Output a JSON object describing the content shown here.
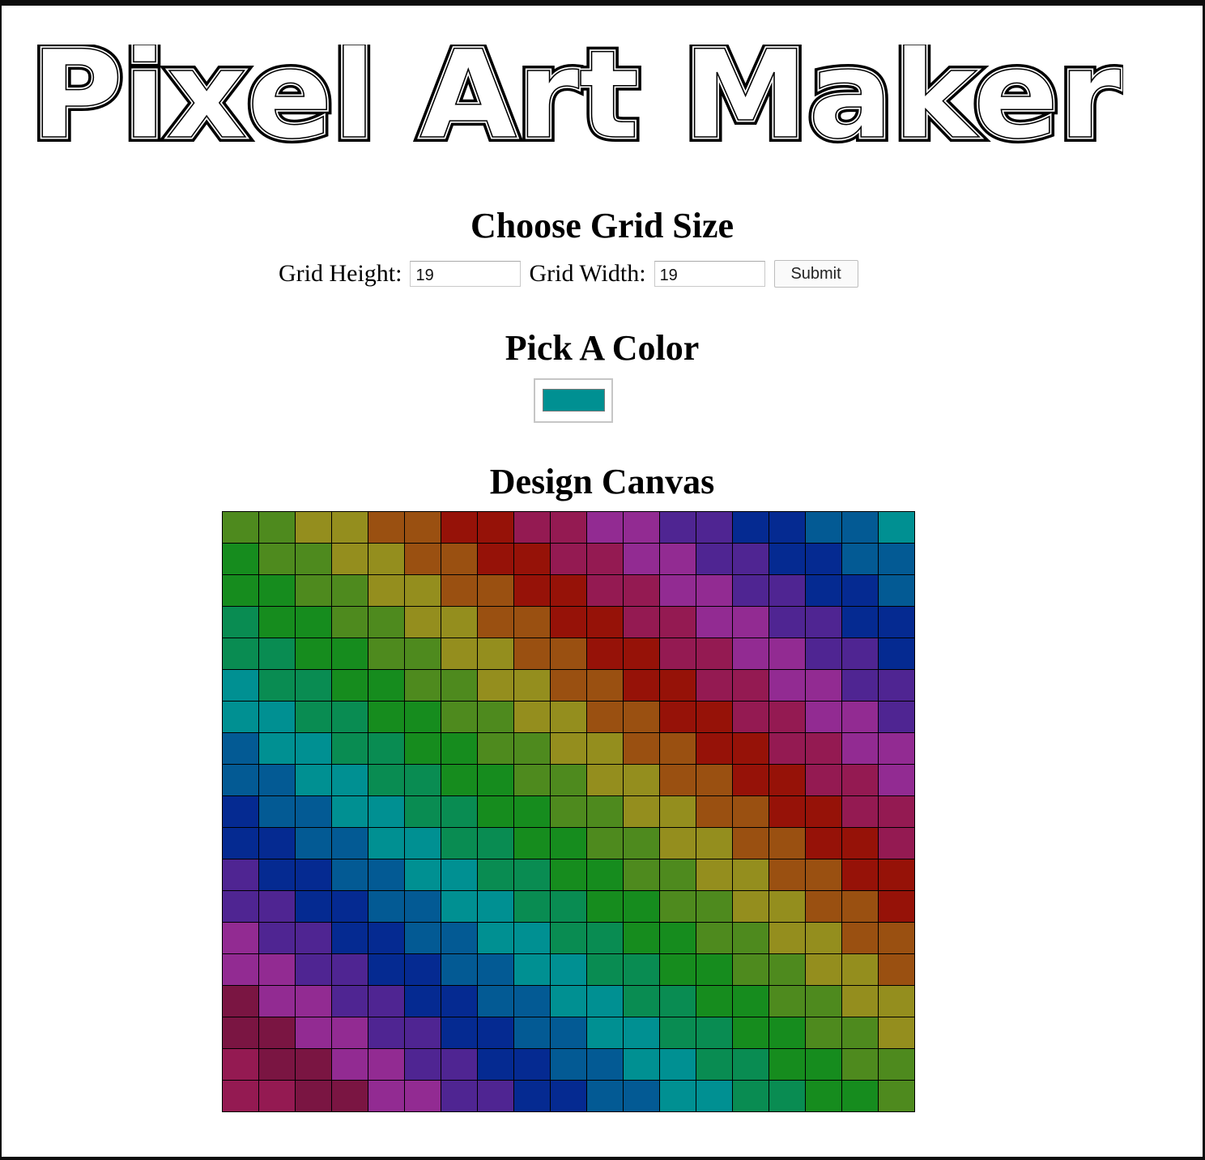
{
  "app": {
    "title": "Pixel Art Maker"
  },
  "grid_size": {
    "heading": "Choose Grid Size",
    "height_label": "Grid Height:",
    "height_value": "19",
    "width_label": "Grid Width:",
    "width_value": "19",
    "submit_label": "Submit"
  },
  "color": {
    "heading": "Pick A Color",
    "value": "#009092"
  },
  "canvas": {
    "heading": "Design Canvas",
    "rows": 19,
    "cols": 19,
    "border_color": "#000000",
    "cells": [
      [
        "#4e8a1e",
        "#4e8a1e",
        "#948e1e",
        "#948e1e",
        "#9a5011",
        "#9a5011",
        "#961208",
        "#961208",
        "#941a52",
        "#941a52",
        "#922b92",
        "#922b92",
        "#4f2592",
        "#4f2592",
        "#052a91",
        "#052a91",
        "#035a94",
        "#035a94",
        "#009092"
      ],
      [
        "#168c1e",
        "#4e8a1e",
        "#4e8a1e",
        "#948e1e",
        "#948e1e",
        "#9a5011",
        "#9a5011",
        "#961208",
        "#961208",
        "#941a52",
        "#941a52",
        "#922b92",
        "#922b92",
        "#4f2592",
        "#4f2592",
        "#052a91",
        "#052a91",
        "#035a94",
        "#035a94"
      ],
      [
        "#168c1e",
        "#168c1e",
        "#4e8a1e",
        "#4e8a1e",
        "#948e1e",
        "#948e1e",
        "#9a5011",
        "#9a5011",
        "#961208",
        "#961208",
        "#941a52",
        "#941a52",
        "#922b92",
        "#922b92",
        "#4f2592",
        "#4f2592",
        "#052a91",
        "#052a91",
        "#035a94"
      ],
      [
        "#098c52",
        "#168c1e",
        "#168c1e",
        "#4e8a1e",
        "#4e8a1e",
        "#948e1e",
        "#948e1e",
        "#9a5011",
        "#9a5011",
        "#961208",
        "#961208",
        "#941a52",
        "#941a52",
        "#922b92",
        "#922b92",
        "#4f2592",
        "#4f2592",
        "#052a91",
        "#052a91"
      ],
      [
        "#098c52",
        "#098c52",
        "#168c1e",
        "#168c1e",
        "#4e8a1e",
        "#4e8a1e",
        "#948e1e",
        "#948e1e",
        "#9a5011",
        "#9a5011",
        "#961208",
        "#961208",
        "#941a52",
        "#941a52",
        "#922b92",
        "#922b92",
        "#4f2592",
        "#4f2592",
        "#052a91"
      ],
      [
        "#009092",
        "#098c52",
        "#098c52",
        "#168c1e",
        "#168c1e",
        "#4e8a1e",
        "#4e8a1e",
        "#948e1e",
        "#948e1e",
        "#9a5011",
        "#9a5011",
        "#961208",
        "#961208",
        "#941a52",
        "#941a52",
        "#922b92",
        "#922b92",
        "#4f2592",
        "#4f2592"
      ],
      [
        "#009092",
        "#009092",
        "#098c52",
        "#098c52",
        "#168c1e",
        "#168c1e",
        "#4e8a1e",
        "#4e8a1e",
        "#948e1e",
        "#948e1e",
        "#9a5011",
        "#9a5011",
        "#961208",
        "#961208",
        "#941a52",
        "#941a52",
        "#922b92",
        "#922b92",
        "#4f2592"
      ],
      [
        "#035a94",
        "#009092",
        "#009092",
        "#098c52",
        "#098c52",
        "#168c1e",
        "#168c1e",
        "#4e8a1e",
        "#4e8a1e",
        "#948e1e",
        "#948e1e",
        "#9a5011",
        "#9a5011",
        "#961208",
        "#961208",
        "#941a52",
        "#941a52",
        "#922b92",
        "#922b92"
      ],
      [
        "#035a94",
        "#035a94",
        "#009092",
        "#009092",
        "#098c52",
        "#098c52",
        "#168c1e",
        "#168c1e",
        "#4e8a1e",
        "#4e8a1e",
        "#948e1e",
        "#948e1e",
        "#9a5011",
        "#9a5011",
        "#961208",
        "#961208",
        "#941a52",
        "#941a52",
        "#922b92"
      ],
      [
        "#052a91",
        "#035a94",
        "#035a94",
        "#009092",
        "#009092",
        "#098c52",
        "#098c52",
        "#168c1e",
        "#168c1e",
        "#4e8a1e",
        "#4e8a1e",
        "#948e1e",
        "#948e1e",
        "#9a5011",
        "#9a5011",
        "#961208",
        "#961208",
        "#941a52",
        "#941a52"
      ],
      [
        "#052a91",
        "#052a91",
        "#035a94",
        "#035a94",
        "#009092",
        "#009092",
        "#098c52",
        "#098c52",
        "#168c1e",
        "#168c1e",
        "#4e8a1e",
        "#4e8a1e",
        "#948e1e",
        "#948e1e",
        "#9a5011",
        "#9a5011",
        "#961208",
        "#961208",
        "#941a52"
      ],
      [
        "#4f2592",
        "#052a91",
        "#052a91",
        "#035a94",
        "#035a94",
        "#009092",
        "#009092",
        "#098c52",
        "#098c52",
        "#168c1e",
        "#168c1e",
        "#4e8a1e",
        "#4e8a1e",
        "#948e1e",
        "#948e1e",
        "#9a5011",
        "#9a5011",
        "#961208",
        "#961208"
      ],
      [
        "#4f2592",
        "#4f2592",
        "#052a91",
        "#052a91",
        "#035a94",
        "#035a94",
        "#009092",
        "#009092",
        "#098c52",
        "#098c52",
        "#168c1e",
        "#168c1e",
        "#4e8a1e",
        "#4e8a1e",
        "#948e1e",
        "#948e1e",
        "#9a5011",
        "#9a5011",
        "#961208"
      ],
      [
        "#922b92",
        "#4f2592",
        "#4f2592",
        "#052a91",
        "#052a91",
        "#035a94",
        "#035a94",
        "#009092",
        "#009092",
        "#098c52",
        "#098c52",
        "#168c1e",
        "#168c1e",
        "#4e8a1e",
        "#4e8a1e",
        "#948e1e",
        "#948e1e",
        "#9a5011",
        "#9a5011"
      ],
      [
        "#922b92",
        "#922b92",
        "#4f2592",
        "#4f2592",
        "#052a91",
        "#052a91",
        "#035a94",
        "#035a94",
        "#009092",
        "#009092",
        "#098c52",
        "#098c52",
        "#168c1e",
        "#168c1e",
        "#4e8a1e",
        "#4e8a1e",
        "#948e1e",
        "#948e1e",
        "#9a5011"
      ],
      [
        "#7a1542",
        "#922b92",
        "#922b92",
        "#4f2592",
        "#4f2592",
        "#052a91",
        "#052a91",
        "#035a94",
        "#035a94",
        "#009092",
        "#009092",
        "#098c52",
        "#098c52",
        "#168c1e",
        "#168c1e",
        "#4e8a1e",
        "#4e8a1e",
        "#948e1e",
        "#948e1e"
      ],
      [
        "#7a1542",
        "#7a1542",
        "#922b92",
        "#922b92",
        "#4f2592",
        "#4f2592",
        "#052a91",
        "#052a91",
        "#035a94",
        "#035a94",
        "#009092",
        "#009092",
        "#098c52",
        "#098c52",
        "#168c1e",
        "#168c1e",
        "#4e8a1e",
        "#4e8a1e",
        "#948e1e"
      ],
      [
        "#941a52",
        "#7a1542",
        "#7a1542",
        "#922b92",
        "#922b92",
        "#4f2592",
        "#4f2592",
        "#052a91",
        "#052a91",
        "#035a94",
        "#035a94",
        "#009092",
        "#009092",
        "#098c52",
        "#098c52",
        "#168c1e",
        "#168c1e",
        "#4e8a1e",
        "#4e8a1e"
      ],
      [
        "#941a52",
        "#941a52",
        "#7a1542",
        "#7a1542",
        "#922b92",
        "#922b92",
        "#4f2592",
        "#4f2592",
        "#052a91",
        "#052a91",
        "#035a94",
        "#035a94",
        "#009092",
        "#009092",
        "#098c52",
        "#098c52",
        "#168c1e",
        "#168c1e",
        "#4e8a1e"
      ]
    ]
  }
}
